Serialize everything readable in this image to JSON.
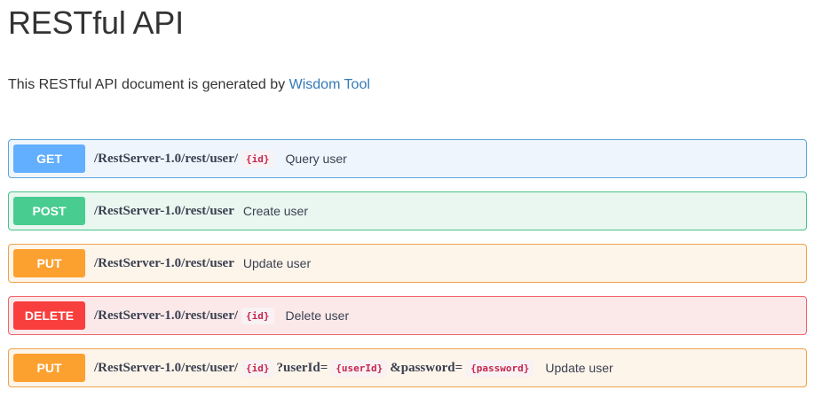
{
  "title": "RESTful API",
  "intro": {
    "text": "This RESTful API document is generated by ",
    "link_label": "Wisdom Tool"
  },
  "colors": {
    "get": "#61affe",
    "post": "#49cc90",
    "put": "#fca130",
    "delete": "#f93e3e",
    "link": "#337ab7",
    "param": "#c7254e"
  },
  "operations": [
    {
      "method": "GET",
      "path": "/RestServer-1.0/rest/user/",
      "param": "{id}",
      "summary": "Query user"
    },
    {
      "method": "POST",
      "path": "/RestServer-1.0/rest/user",
      "summary": "Create user"
    },
    {
      "method": "PUT",
      "path": "/RestServer-1.0/rest/user",
      "summary": "Update user"
    },
    {
      "method": "DELETE",
      "path": "/RestServer-1.0/rest/user/",
      "param": "{id}",
      "summary": "Delete user"
    },
    {
      "method": "PUT",
      "path": "/RestServer-1.0/rest/user/",
      "param": "{id}",
      "query1_prefix": "?userId=",
      "query1_param": "{userId}",
      "query2_prefix": "&password=",
      "query2_param": "{password}",
      "summary": "Update user"
    }
  ]
}
